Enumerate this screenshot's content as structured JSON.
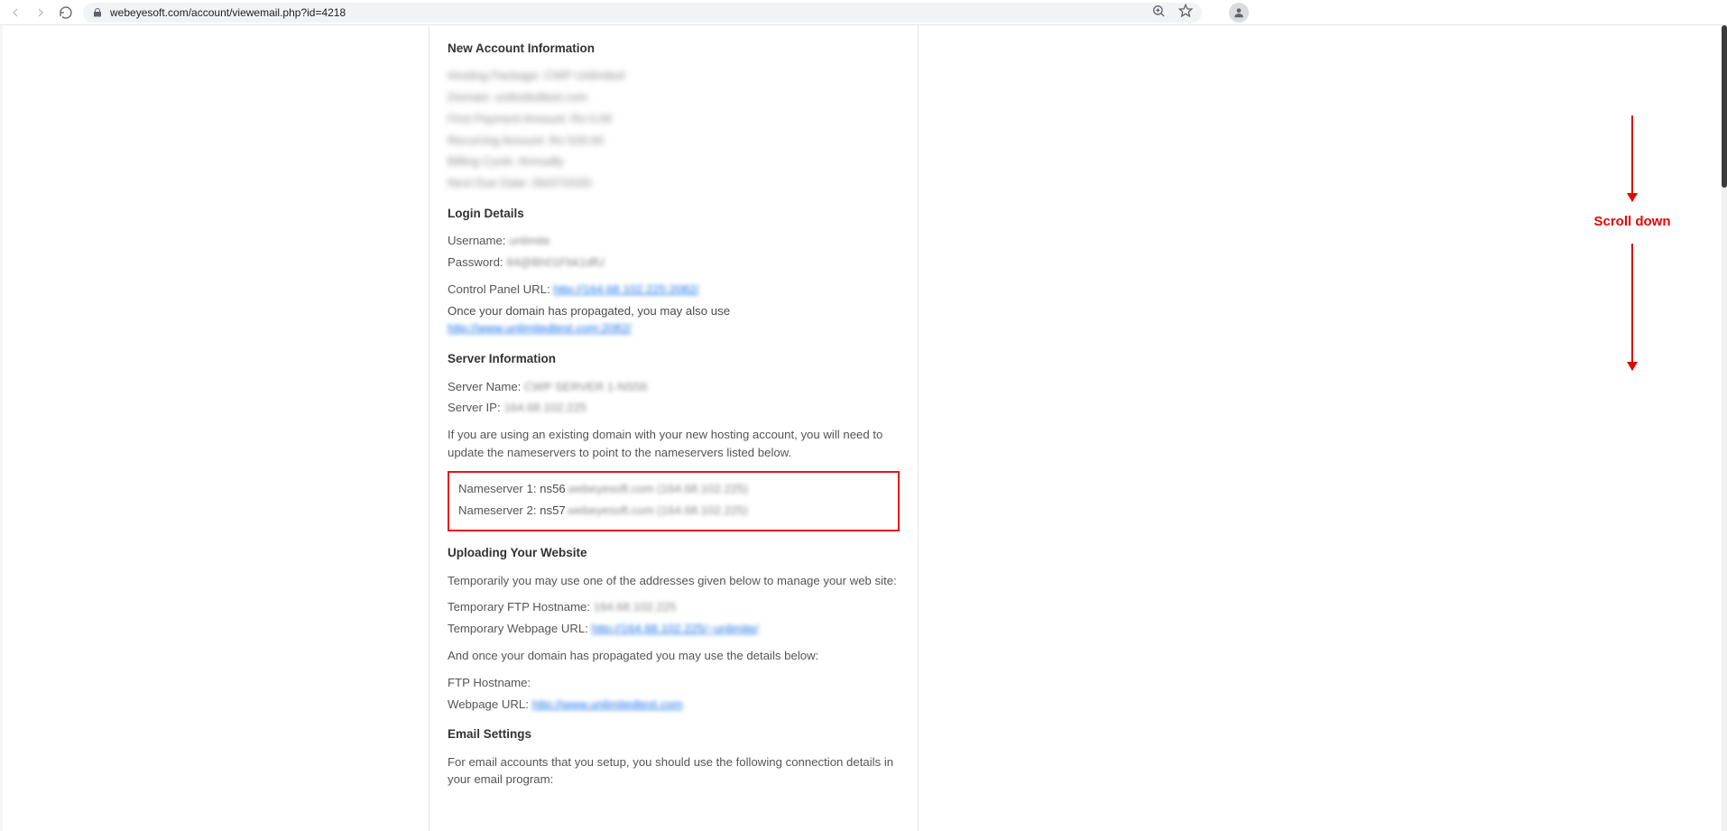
{
  "browser": {
    "url": "webeyesoft.com/account/viewemail.php?id=4218"
  },
  "annotation": {
    "label": "Scroll down"
  },
  "email": {
    "sections": {
      "account_info": {
        "heading": "New Account Information",
        "lines": {
          "hosting_package_label": "Hosting Package:",
          "hosting_package_value": "CWP Unlimited",
          "domain_label": "Domain:",
          "domain_value": "unlimitedtest.com",
          "first_payment_label": "First Payment Amount:",
          "first_payment_value": "Rs 0.00",
          "recurring_label": "Recurring Amount:",
          "recurring_value": "Rs 529.00",
          "billing_cycle_label": "Billing Cycle:",
          "billing_cycle_value": "Annually",
          "next_due_label": "Next Due Date:",
          "next_due_value": "06/07/2020"
        }
      },
      "login": {
        "heading": "Login Details",
        "username_label": "Username:",
        "username_value": "unlimite",
        "password_label": "Password:",
        "password_value": "84@Bh01Fbk1dfU",
        "cp_url_label": "Control Panel URL:",
        "cp_url_value": "http://164.68.102.225:2082/",
        "propagated_prefix": "Once your domain has propagated, you may also use ",
        "propagated_link": "http://www.unlimitedtest.com:2082/"
      },
      "server": {
        "heading": "Server Information",
        "name_label": "Server Name:",
        "name_value": "CWP SERVER 1-NS56",
        "ip_label": "Server IP:",
        "ip_value": "164.68.102.225",
        "ns_intro": "If you are using an existing domain with your new hosting account, you will need to update the nameservers to point to the nameservers listed below.",
        "ns1_label": "Nameserver 1:",
        "ns1_host": "ns56.webeyesoft.com",
        "ns1_ip": "(164.68.102.225)",
        "ns2_label": "Nameserver 2:",
        "ns2_host": "ns57.webeyesoft.com",
        "ns2_ip": "(164.68.102.225)"
      },
      "upload": {
        "heading": "Uploading Your Website",
        "temp_intro": "Temporarily you may use one of the addresses given below to manage your web site:",
        "temp_ftp_label": "Temporary FTP Hostname:",
        "temp_ftp_value": "164.68.102.225",
        "temp_url_label": "Temporary Webpage URL:",
        "temp_url_value": "http://164.68.102.225/~unlimite/",
        "after_prop": "And once your domain has propagated you may use the details below:",
        "ftp_label": "FTP Hostname:",
        "web_url_label": "Webpage URL:",
        "web_url_value": "http://www.unlimitedtest.com"
      },
      "email_settings": {
        "heading": "Email Settings",
        "intro": "For email accounts that you setup, you should use the following connection details in your email program:"
      }
    }
  }
}
